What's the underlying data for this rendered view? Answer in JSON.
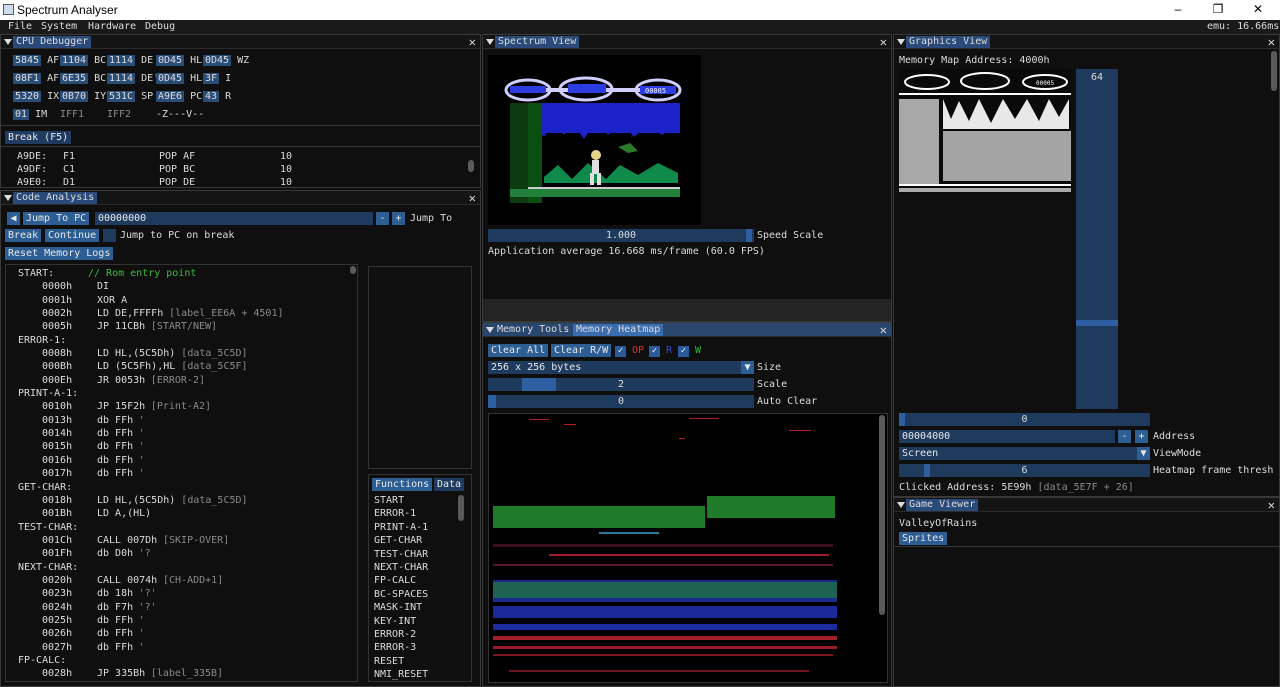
{
  "window": {
    "title": "Spectrum Analyser",
    "min": "–",
    "max": "❐",
    "close": "✕"
  },
  "menu": {
    "items": [
      "File",
      "System",
      "Hardware",
      "Debug"
    ],
    "emu": "emu: 16.66ms"
  },
  "cpu": {
    "title": "CPU Debugger",
    "regs": [
      [
        "5845",
        "AF",
        "1104",
        "BC",
        "1114",
        "DE",
        "0D45",
        "HL",
        "0D45",
        "WZ"
      ],
      [
        "08F1",
        "AF'",
        "6E35",
        "BC'",
        "1114",
        "DE'",
        "0D45",
        "HL'",
        "3F",
        "I"
      ],
      [
        "5320",
        "IX",
        "0B70",
        "IY",
        "531C",
        "SP",
        "A9E6",
        "PC",
        "43",
        "R"
      ]
    ],
    "im": "01",
    "im_label": "IM",
    "iff1": "IFF1",
    "iff2": "IFF2",
    "flags": "-Z---V--",
    "break_btn": "Break (F5)",
    "dis": [
      [
        "A9DE:",
        "F1",
        "POP AF",
        "10"
      ],
      [
        "A9DF:",
        "C1",
        "POP BC",
        "10"
      ],
      [
        "A9E0:",
        "D1",
        "POP DE",
        "10"
      ]
    ]
  },
  "code": {
    "title": "Code Analysis",
    "jump_btn": "Jump To PC",
    "jump_addr": "00000000",
    "minus": "-",
    "plus": "+",
    "jump_label": "Jump To",
    "break": "Break",
    "continue": "Continue",
    "jump_break": "Jump to PC on break",
    "reset": "Reset Memory Logs",
    "lines": [
      {
        "l": "START:",
        "c": "// Rom entry point"
      },
      {
        "a": "0000h",
        "i": "DI"
      },
      {
        "a": "0001h",
        "i": "XOR A"
      },
      {
        "a": "0002h",
        "i": "LD DE,FFFFh",
        "r": "[label_EE6A + 4501]"
      },
      {
        "a": "0005h",
        "i": "JP 11CBh",
        "r": "[START/NEW]"
      },
      {
        "l": "ERROR-1:"
      },
      {
        "a": "0008h",
        "i": "LD HL,(5C5Dh)",
        "r": "[data_5C5D]"
      },
      {
        "a": "000Bh",
        "i": "LD (5C5Fh),HL",
        "r": "[data_5C5F]"
      },
      {
        "a": "000Eh",
        "i": "JR 0053h",
        "r": "[ERROR-2]"
      },
      {
        "l": "PRINT-A-1:"
      },
      {
        "a": "0010h",
        "i": "JP 15F2h",
        "r": "[Print-A2]"
      },
      {
        "a": "0013h",
        "i": "db FFh",
        "r": "'"
      },
      {
        "a": "0014h",
        "i": "db FFh",
        "r": "'"
      },
      {
        "a": "0015h",
        "i": "db FFh",
        "r": "'"
      },
      {
        "a": "0016h",
        "i": "db FFh",
        "r": "'"
      },
      {
        "a": "0017h",
        "i": "db FFh",
        "r": "'"
      },
      {
        "l": "GET-CHAR:"
      },
      {
        "a": "0018h",
        "i": "LD HL,(5C5Dh)",
        "r": "[data_5C5D]"
      },
      {
        "a": "001Bh",
        "i": "LD A,(HL)"
      },
      {
        "l": "TEST-CHAR:"
      },
      {
        "a": "001Ch",
        "i": "CALL 007Dh",
        "r": "[SKIP-OVER]"
      },
      {
        "a": "001Fh",
        "i": "db D0h",
        "r": "'?"
      },
      {
        "l": "NEXT-CHAR:"
      },
      {
        "a": "0020h",
        "i": "CALL 0074h",
        "r": "[CH-ADD+1]"
      },
      {
        "a": "0023h",
        "i": "db 18h",
        "r": "'?'"
      },
      {
        "a": "0024h",
        "i": "db F7h",
        "r": "'?'"
      },
      {
        "a": "0025h",
        "i": "db FFh",
        "r": "'"
      },
      {
        "a": "0026h",
        "i": "db FFh",
        "r": "'"
      },
      {
        "a": "0027h",
        "i": "db FFh",
        "r": "'"
      },
      {
        "l": "FP-CALC:"
      },
      {
        "a": "0028h",
        "i": "JP 335Bh",
        "r": "[label_335B]"
      }
    ],
    "tabs": [
      "Functions",
      "Data"
    ],
    "functions": [
      "START",
      "ERROR-1",
      "PRINT-A-1",
      "GET-CHAR",
      "TEST-CHAR",
      "NEXT-CHAR",
      "FP-CALC",
      "BC-SPACES",
      "MASK-INT",
      "KEY-INT",
      "ERROR-2",
      "ERROR-3",
      "RESET",
      "NMI_RESET"
    ]
  },
  "spectrum": {
    "title": "Spectrum View",
    "speed": "1.000",
    "speed_label": "Speed Scale",
    "fps": "Application average 16.668 ms/frame (60.0 FPS)",
    "speed_pct": 0.53,
    "score": "00005"
  },
  "memtools": {
    "tab1": "Memory Tools",
    "tab2": "Memory Heatmap",
    "clear_all": "Clear All",
    "clear_rw": "Clear R/W",
    "checks": [
      {
        "label": "OP",
        "color": "#e03030"
      },
      {
        "label": "R",
        "color": "#2f4fd0"
      },
      {
        "label": "W",
        "color": "#30c030"
      }
    ],
    "size": "256 x 256 bytes",
    "size_label": "Size",
    "scale": "2",
    "scale_label": "Scale",
    "scale_pct": 0.17,
    "auto": "0",
    "auto_label": "Auto Clear"
  },
  "gfx": {
    "title": "Graphics View",
    "map_addr": "Memory Map Address: 4000h",
    "slider": "64",
    "slider_pct": 0.68,
    "address_slider": "0",
    "address": "00004000",
    "address_label": "Address",
    "viewmode": "Screen",
    "viewmode_label": "ViewMode",
    "thresh": "6",
    "thresh_label": "Heatmap frame thresh",
    "thresh_pct": 0.1,
    "clicked": "Clicked Address: 5E99h",
    "clicked_ref": "[data_5E7F + 26]",
    "score": "00005"
  },
  "game": {
    "title": "Game Viewer",
    "name": "ValleyOfRains",
    "sprites": "Sprites"
  },
  "colors": {
    "accent": "#2c5d93",
    "panel_bg": "#0f0f0f",
    "label_green": "#3fba3f"
  }
}
